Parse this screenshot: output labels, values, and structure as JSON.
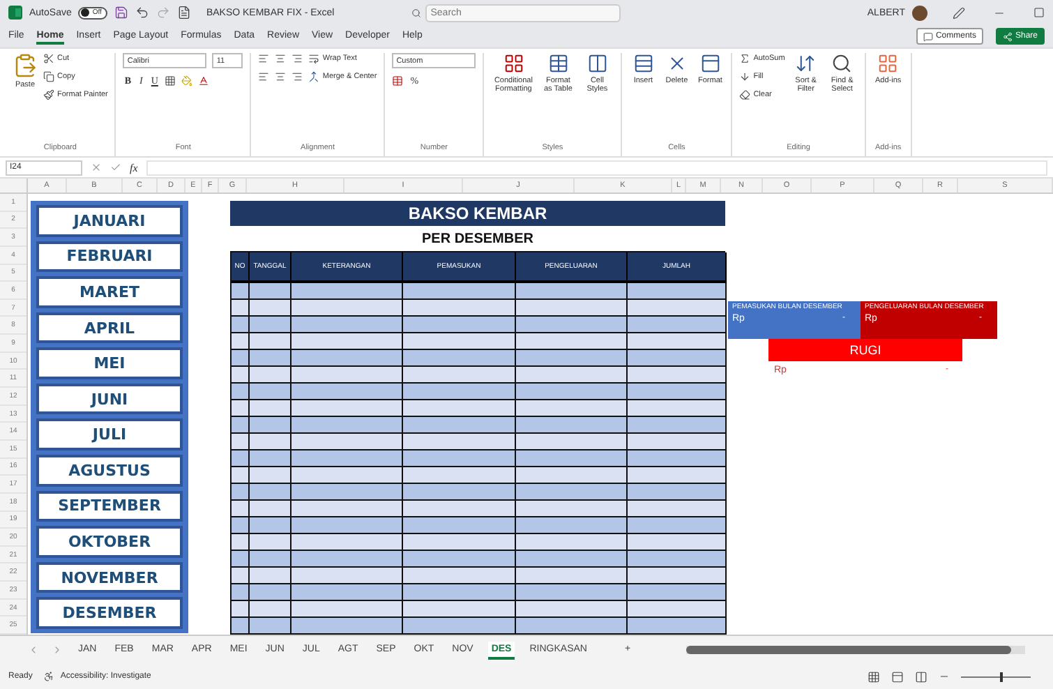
{
  "title_bar": {
    "autosave_label": "AutoSave",
    "autosave_toggle": {
      "label": "Off",
      "on": false
    },
    "document_title": "BAKSO KEMBAR FIX - Excel",
    "search": {
      "placeholder": "Search"
    },
    "user_name": "ALBERT"
  },
  "menu_tabs": [
    {
      "label": "File",
      "selected": false
    },
    {
      "label": "Home",
      "selected": true
    },
    {
      "label": "Insert",
      "selected": false
    },
    {
      "label": "Page Layout",
      "selected": false
    },
    {
      "label": "Formulas",
      "selected": false
    },
    {
      "label": "Data",
      "selected": false
    },
    {
      "label": "Review",
      "selected": false
    },
    {
      "label": "View",
      "selected": false
    },
    {
      "label": "Developer",
      "selected": false
    },
    {
      "label": "Help",
      "selected": false
    }
  ],
  "comments_button": "Comments",
  "share_button": "Share",
  "ribbon_groups": [
    {
      "kind": "clipboard",
      "label": "Clipboard",
      "items": [
        "Paste",
        "Cut",
        "Copy",
        "Format Painter"
      ]
    },
    {
      "kind": "font",
      "label": "Font",
      "items": [
        "Calibri",
        "11",
        "B",
        "I",
        "U"
      ]
    },
    {
      "kind": "alignment",
      "label": "Alignment",
      "items": [
        "Wrap Text",
        "Merge & Center"
      ]
    },
    {
      "kind": "number",
      "label": "Number",
      "items": [
        "Custom",
        "%"
      ]
    },
    {
      "kind": "styles",
      "label": "Styles",
      "items": [
        "Conditional Formatting",
        "Format as Table",
        "Cell Styles"
      ]
    },
    {
      "kind": "cells",
      "label": "Cells",
      "items": [
        "Insert",
        "Delete",
        "Format"
      ]
    },
    {
      "kind": "editing",
      "label": "Editing",
      "items": [
        "AutoSum",
        "Fill",
        "Clear",
        "Sort & Filter",
        "Find & Select"
      ]
    },
    {
      "kind": "addins",
      "label": "Add-ins",
      "items": [
        "Add-ins"
      ]
    }
  ],
  "formula_bar": {
    "name_box": "I24",
    "fx": "fx"
  },
  "column_headers": [
    "A",
    "B",
    "C",
    "D",
    "E",
    "F",
    "G",
    "H",
    "I",
    "J",
    "K",
    "L",
    "M",
    "N",
    "O",
    "P",
    "Q",
    "R",
    "S"
  ],
  "row_headers": [
    "1",
    "2",
    "3",
    "4",
    "5",
    "6",
    "7",
    "8",
    "9",
    "10",
    "11",
    "12",
    "13",
    "14",
    "15",
    "16",
    "17",
    "18",
    "19",
    "20",
    "21",
    "22",
    "23",
    "24",
    "25"
  ],
  "months": [
    "JANUARI",
    "FEBRUARI",
    "MARET",
    "APRIL",
    "MEI",
    "JUNI",
    "JULI",
    "AGUSTUS",
    "SEPTEMBER",
    "OKTOBER",
    "NOVEMBER",
    "DESEMBER"
  ],
  "table": {
    "title": "BAKSO KEMBAR",
    "subtitle": "PER DESEMBER",
    "columns": [
      "NO",
      "TANGGAL",
      "KETERANGAN",
      "PEMASUKAN",
      "PENGELUARAN",
      "JUMLAH"
    ]
  },
  "summary": {
    "income": {
      "label": "PEMASUKAN BULAN DESEMBER",
      "currency": "Rp",
      "value": "-"
    },
    "expense": {
      "label": "PENGELUARAN BULAN DESEMBER",
      "currency": "Rp",
      "value": "-"
    },
    "result": {
      "label": "RUGI",
      "currency": "Rp",
      "value": "-"
    }
  },
  "sheet_tabs": [
    {
      "label": "JAN",
      "selected": false
    },
    {
      "label": "FEB",
      "selected": false
    },
    {
      "label": "MAR",
      "selected": false
    },
    {
      "label": "APR",
      "selected": false
    },
    {
      "label": "MEI",
      "selected": false
    },
    {
      "label": "JUN",
      "selected": false
    },
    {
      "label": "JUL",
      "selected": false
    },
    {
      "label": "AGT",
      "selected": false
    },
    {
      "label": "SEP",
      "selected": false
    },
    {
      "label": "OKT",
      "selected": false
    },
    {
      "label": "NOV",
      "selected": false
    },
    {
      "label": "DES",
      "selected": true
    },
    {
      "label": "RINGKASAN",
      "selected": false
    }
  ],
  "add_sheet": "+",
  "status_bar": {
    "ready": "Ready",
    "accessibility": "Accessibility: Investigate",
    "zoom": {
      "level": 0.55
    }
  }
}
